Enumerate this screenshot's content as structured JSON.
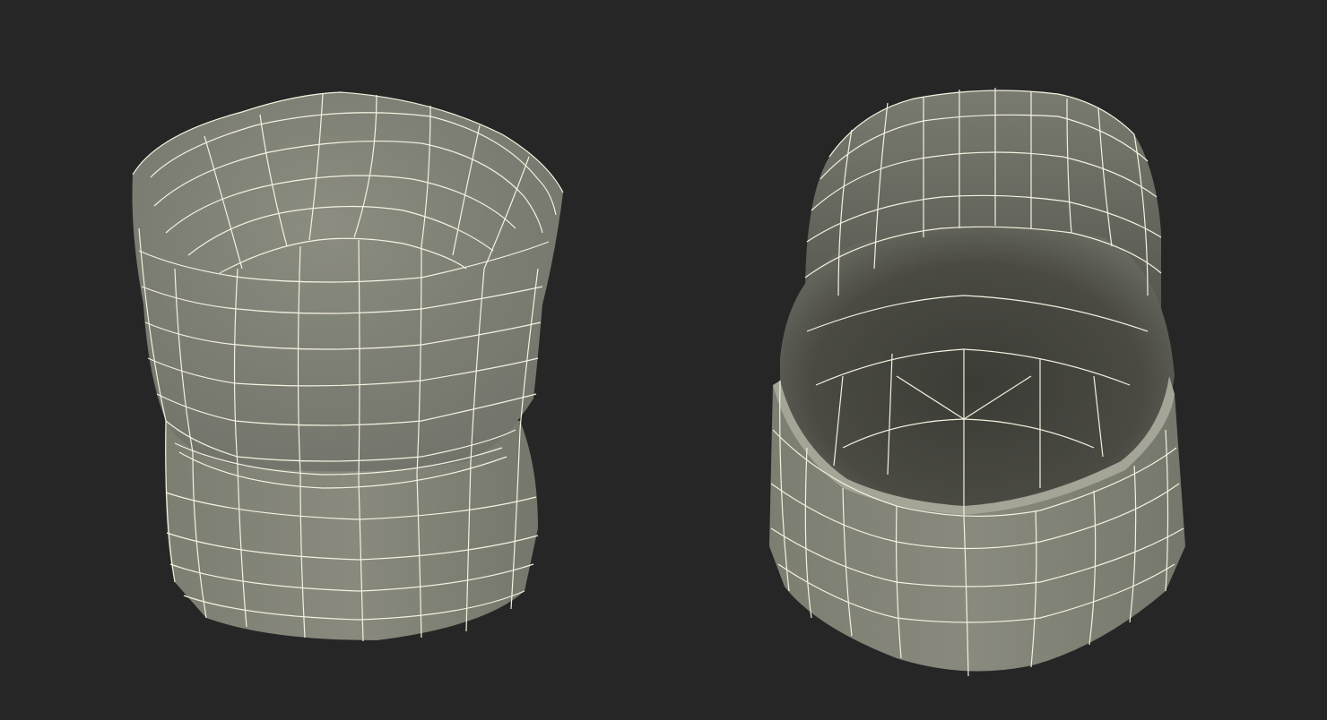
{
  "scene": {
    "background_color": "#262626",
    "mesh_surface_color": "#85867a",
    "mesh_inner_color": "#47473f",
    "wire_color": "#f4f1df",
    "objects": [
      {
        "name": "closed-cap-mesh",
        "view": "outside"
      },
      {
        "name": "open-cap-mesh",
        "view": "inside"
      }
    ]
  }
}
